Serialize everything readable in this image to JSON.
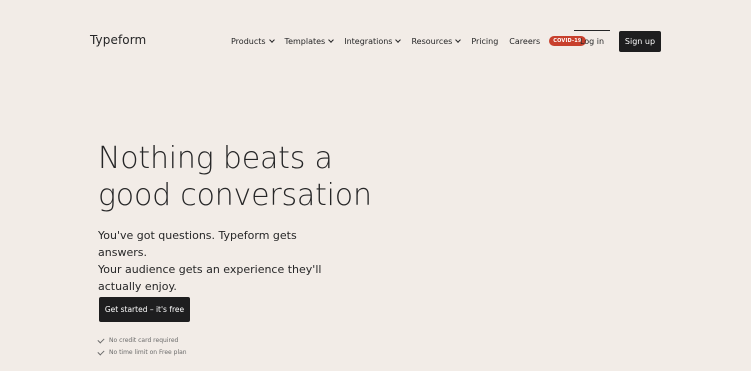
{
  "header": {
    "logo": "Typeform",
    "nav": [
      {
        "label": "Products",
        "has_dropdown": true
      },
      {
        "label": "Templates",
        "has_dropdown": true
      },
      {
        "label": "Integrations",
        "has_dropdown": true
      },
      {
        "label": "Resources",
        "has_dropdown": true
      },
      {
        "label": "Pricing",
        "has_dropdown": false
      },
      {
        "label": "Careers",
        "has_dropdown": false
      }
    ],
    "badge": "COVID-19",
    "login": "Log in",
    "signup": "Sign up"
  },
  "hero": {
    "title_line1": "Nothing beats a",
    "title_line2": "good conversation",
    "subtitle_line1": "You've got questions. Typeform gets answers.",
    "subtitle_line2": "Your audience gets an experience they'll",
    "subtitle_line3": "actually enjoy.",
    "cta": "Get started – it's free",
    "perks": [
      "No credit card required",
      "No time limit on Free plan"
    ]
  },
  "colors": {
    "background": "#f2ece7",
    "text": "#262627",
    "button": "#1e1e1f",
    "badge": "#c8402d"
  }
}
